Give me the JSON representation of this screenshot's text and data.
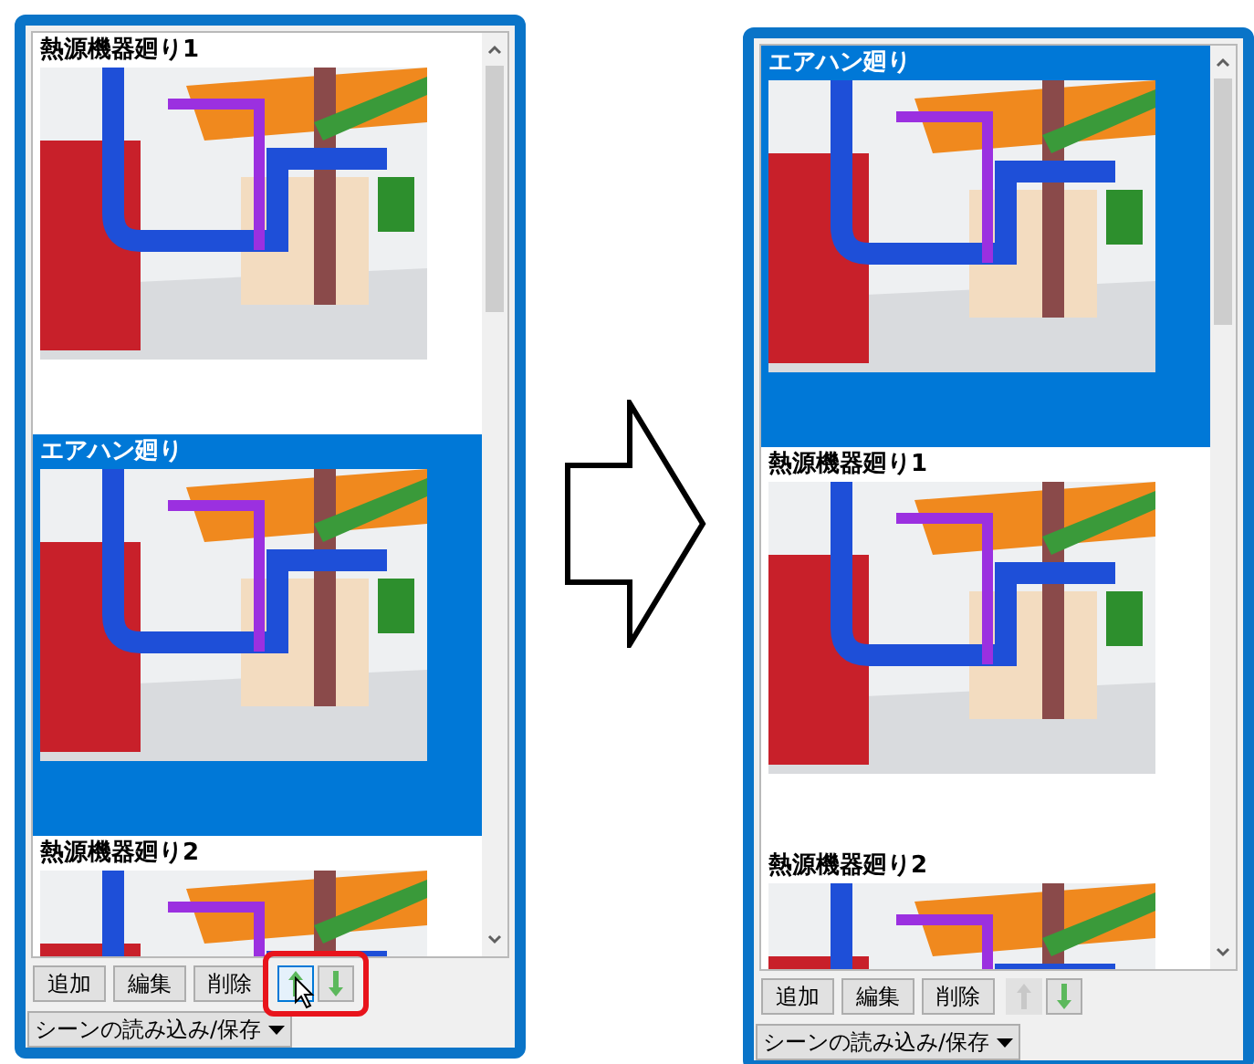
{
  "panels": [
    {
      "scenes": [
        {
          "title": "熱源機器廻り1",
          "selected": false
        },
        {
          "title": "エアハン廻り",
          "selected": true
        },
        {
          "title": "熱源機器廻り2",
          "selected": false
        }
      ],
      "buttons": [
        "追加",
        "編集",
        "削除"
      ],
      "up_button": {
        "disabled": false,
        "hovered": true,
        "highlighted": true
      },
      "down_button": {
        "disabled": false
      },
      "menu": {
        "label": "シーンの読み込み/保存"
      }
    },
    {
      "scenes": [
        {
          "title": "エアハン廻り",
          "selected": true
        },
        {
          "title": "熱源機器廻り1",
          "selected": false
        },
        {
          "title": "熱源機器廻り2",
          "selected": false
        }
      ],
      "buttons": [
        "追加",
        "編集",
        "削除"
      ],
      "up_button": {
        "disabled": true,
        "hovered": false
      },
      "down_button": {
        "disabled": false
      },
      "menu": {
        "label": "シーンの読み込み/保存"
      }
    }
  ]
}
